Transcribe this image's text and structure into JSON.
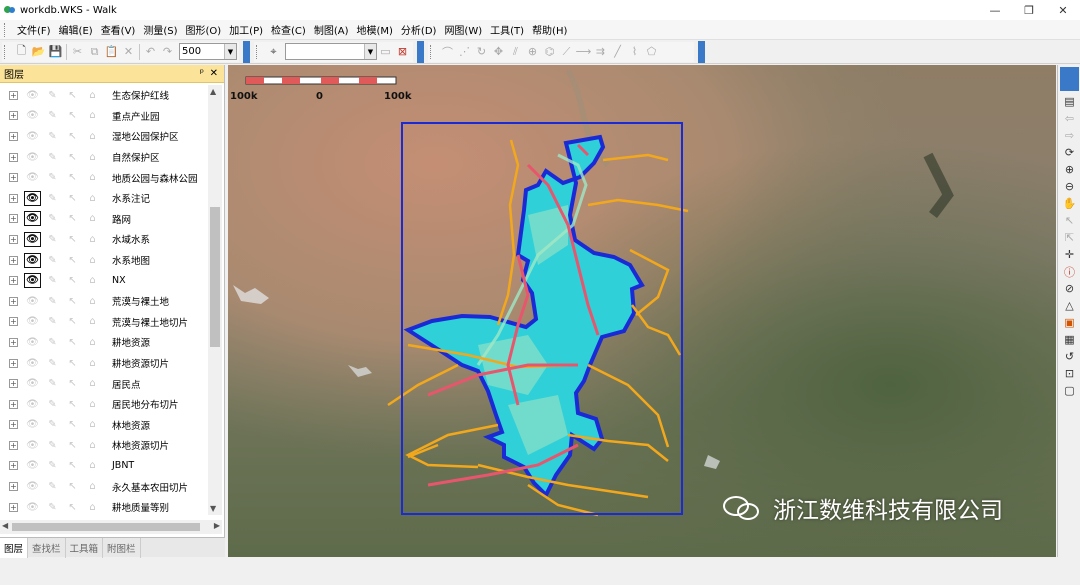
{
  "window": {
    "title": "workdb.WKS - Walk",
    "minimize": "—",
    "maximize": "❐",
    "close": "✕"
  },
  "menu": [
    "文件(F)",
    "编辑(E)",
    "查看(V)",
    "测量(S)",
    "图形(O)",
    "加工(P)",
    "检查(C)",
    "制图(A)",
    "地模(M)",
    "分析(D)",
    "网图(W)",
    "工具(T)",
    "帮助(H)"
  ],
  "toolbar": {
    "scale_value": "500",
    "layer_combo_value": ""
  },
  "layers_panel": {
    "title": "图层",
    "pin": "ᵖ",
    "close": "✕",
    "items": [
      {
        "label": "生态保护红线",
        "visible": false
      },
      {
        "label": "重点产业园",
        "visible": false
      },
      {
        "label": "湿地公园保护区",
        "visible": false
      },
      {
        "label": "自然保护区",
        "visible": false
      },
      {
        "label": "地质公园与森林公园",
        "visible": false
      },
      {
        "label": "水系注记",
        "visible": true
      },
      {
        "label": "路网",
        "visible": true
      },
      {
        "label": "水域水系",
        "visible": true
      },
      {
        "label": "水系地图",
        "visible": true
      },
      {
        "label": "NX",
        "visible": true
      },
      {
        "label": "荒漠与裸土地",
        "visible": false
      },
      {
        "label": "荒漠与裸土地切片",
        "visible": false
      },
      {
        "label": "耕地资源",
        "visible": false
      },
      {
        "label": "耕地资源切片",
        "visible": false
      },
      {
        "label": "居民点",
        "visible": false
      },
      {
        "label": "居民地分布切片",
        "visible": false
      },
      {
        "label": "林地资源",
        "visible": false
      },
      {
        "label": "林地资源切片",
        "visible": false
      },
      {
        "label": "JBNT",
        "visible": false
      },
      {
        "label": "永久基本农田切片",
        "visible": false
      },
      {
        "label": "耕地质量等别",
        "visible": false
      }
    ],
    "tabs": [
      "图层",
      "查找栏",
      "工具箱",
      "附图栏"
    ]
  },
  "map": {
    "scale_bar": {
      "left": "100k",
      "center": "0",
      "right": "100k"
    },
    "watermark": "浙江数维科技有限公司"
  },
  "colors": {
    "panel_header": "#fbe39a",
    "toolbar_accent": "#3a78c8",
    "boundary": "#1a2bd6",
    "water": "#22e6e6",
    "road": "#f2a81c",
    "highway": "#e8566e"
  }
}
